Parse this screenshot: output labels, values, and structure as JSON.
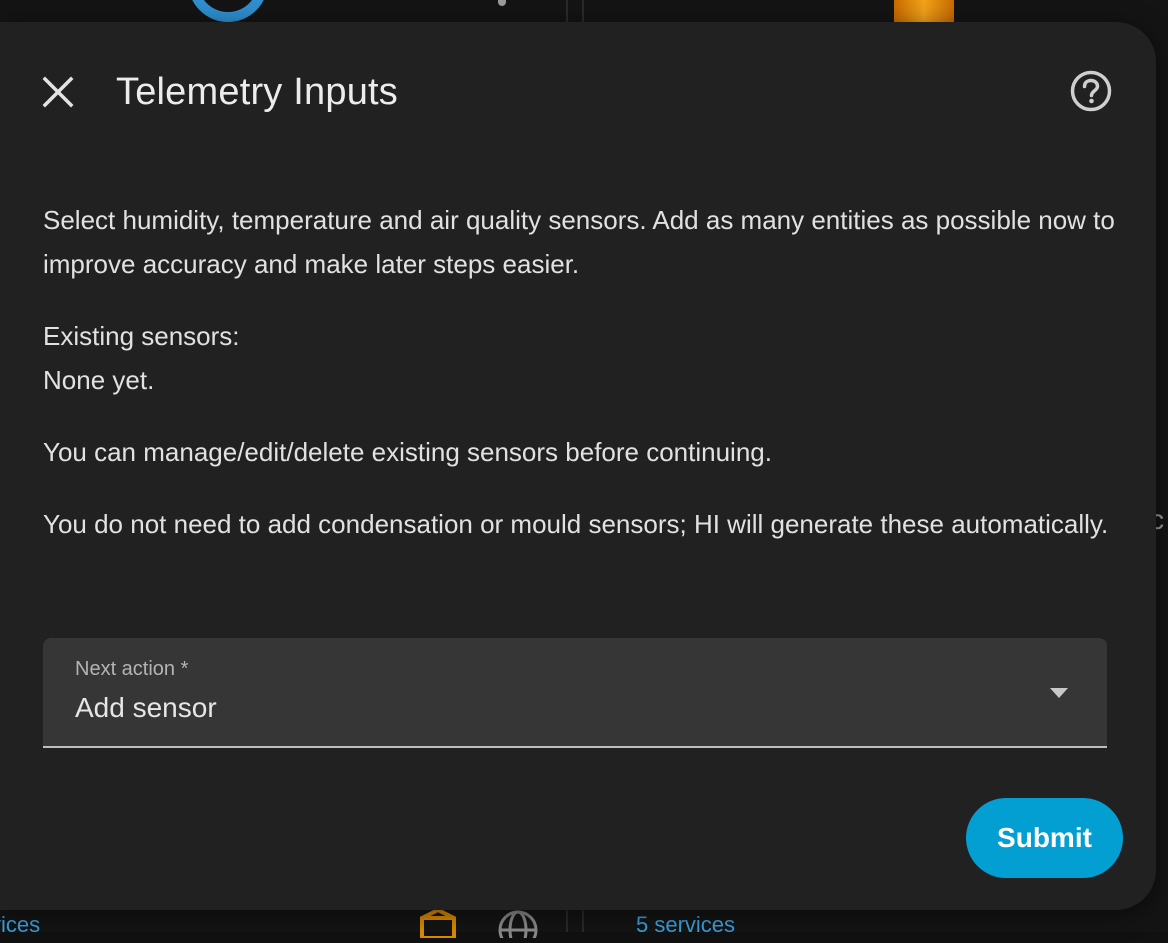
{
  "background": {
    "link_left": "vices",
    "link_right": "5 services",
    "edge_text": "c"
  },
  "dialog": {
    "title": "Telemetry Inputs",
    "close_icon": "close-icon",
    "help_icon": "help-circle-icon",
    "paragraphs": {
      "intro": "Select humidity, temperature and air quality sensors. Add as many entities as possible now to improve accuracy and make later steps easier.",
      "existing_label": "Existing sensors:",
      "existing_value": "None yet.",
      "manage": "You can manage/edit/delete existing sensors before continuing.",
      "note": "You do not need to add condensation or mould sensors; HI will generate these automatically."
    },
    "next_action": {
      "label": "Next action *",
      "value": "Add sensor"
    },
    "submit_label": "Submit"
  },
  "colors": {
    "dialog_bg": "#212121",
    "accent": "#039fd3",
    "field_bg": "#363636"
  }
}
